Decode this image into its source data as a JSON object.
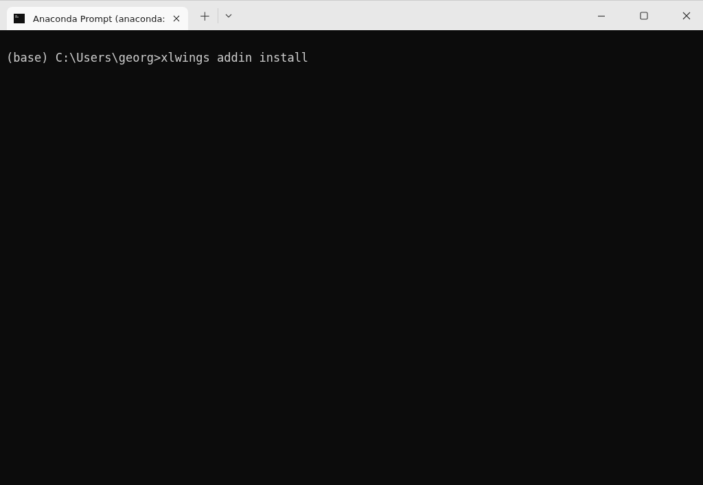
{
  "tabs": [
    {
      "label": "Anaconda Prompt (anaconda:",
      "selected": true
    }
  ],
  "new_tab": "+",
  "terminal": {
    "lines": [
      "(base) C:\\Users\\georg>xlwings addin install"
    ]
  }
}
